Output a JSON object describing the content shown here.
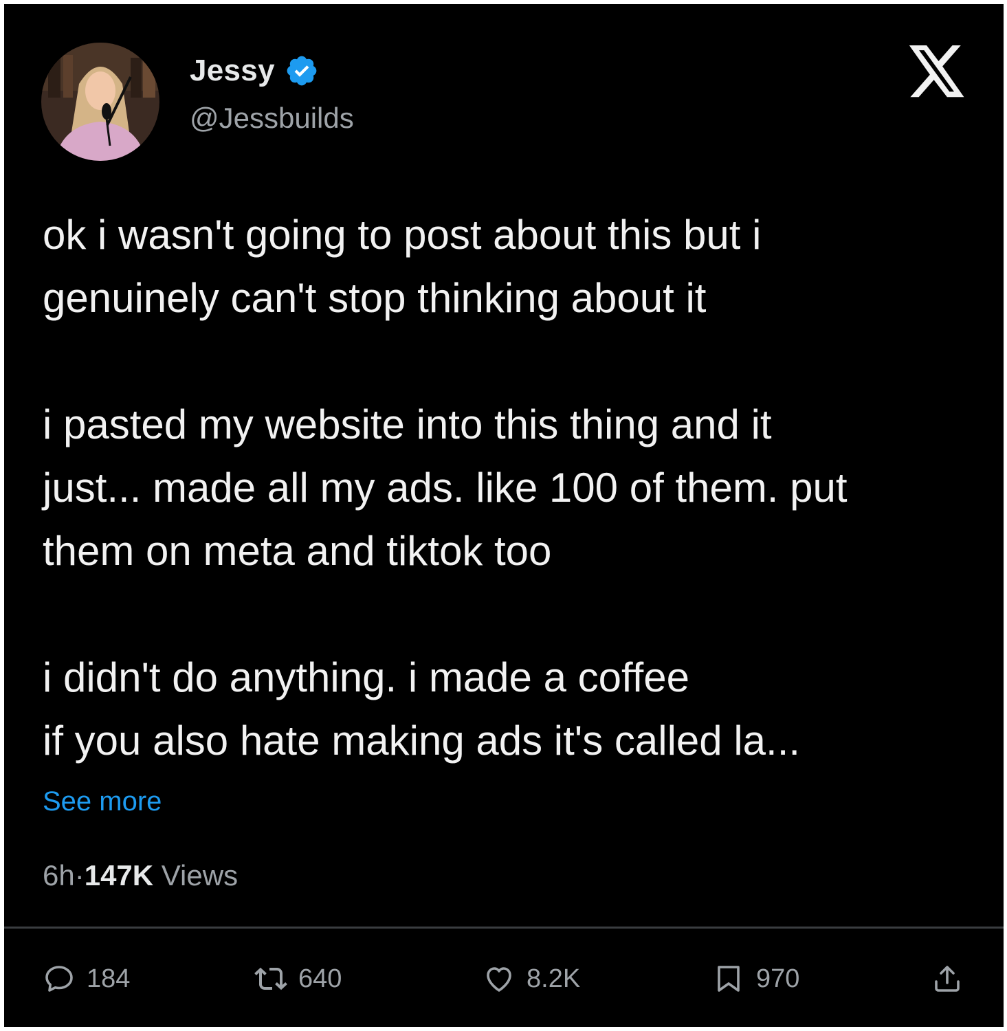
{
  "author": {
    "display_name": "Jessy",
    "handle": "@Jessbuilds",
    "verified": true,
    "avatar_icon": "profile-photo"
  },
  "brand": {
    "logo_icon": "x-logo-icon"
  },
  "tweet": {
    "text": "ok i wasn't going to post about this but i\ngenuinely can't stop thinking about it\n\ni pasted my website into this thing and it\njust... made all my ads. like 100 of them. put\nthem on meta and tiktok too\n\ni didn't do anything. i made a coffee\nif you also hate making ads it's called la...",
    "see_more_label": "See more",
    "time": "6h",
    "separator": "·",
    "views_count": "147K",
    "views_label": " Views"
  },
  "actions": {
    "replies": "184",
    "reposts": "640",
    "likes": "8.2K",
    "bookmarks": "970"
  },
  "colors": {
    "background": "#000000",
    "text": "#e7e9ea",
    "muted": "#9ea3a8",
    "accent": "#1d9bf0"
  }
}
